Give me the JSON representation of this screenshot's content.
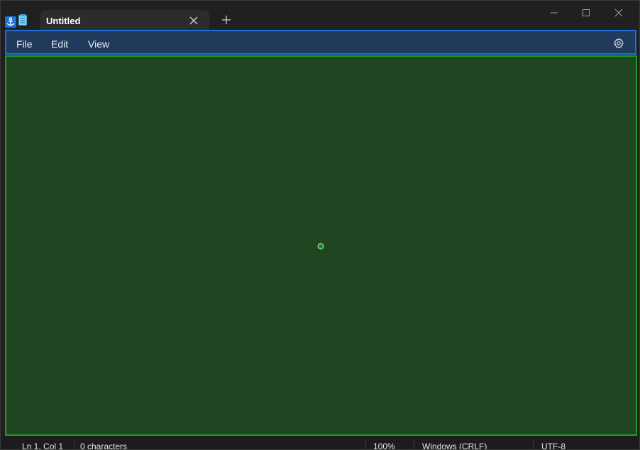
{
  "tab": {
    "title": "Untitled"
  },
  "menu": {
    "file": "File",
    "edit": "Edit",
    "view": "View"
  },
  "status": {
    "position": "Ln 1, Col 1",
    "characters": "0 characters",
    "zoom": "100%",
    "line_ending": "Windows (CRLF)",
    "encoding": "UTF-8"
  },
  "icons": {
    "app": "notepad-icon",
    "tab_close": "close-icon",
    "new_tab": "plus-icon",
    "minimize": "minimize-icon",
    "maximize": "maximize-icon",
    "close": "close-icon",
    "settings": "gear-icon",
    "anchor": "anchor-icon",
    "target": "target-icon"
  },
  "colors": {
    "menubar_overlay": "#203a5c",
    "menubar_border": "#1e6fd8",
    "editor_overlay": "#1f4621",
    "editor_border": "#1f9a2a"
  }
}
